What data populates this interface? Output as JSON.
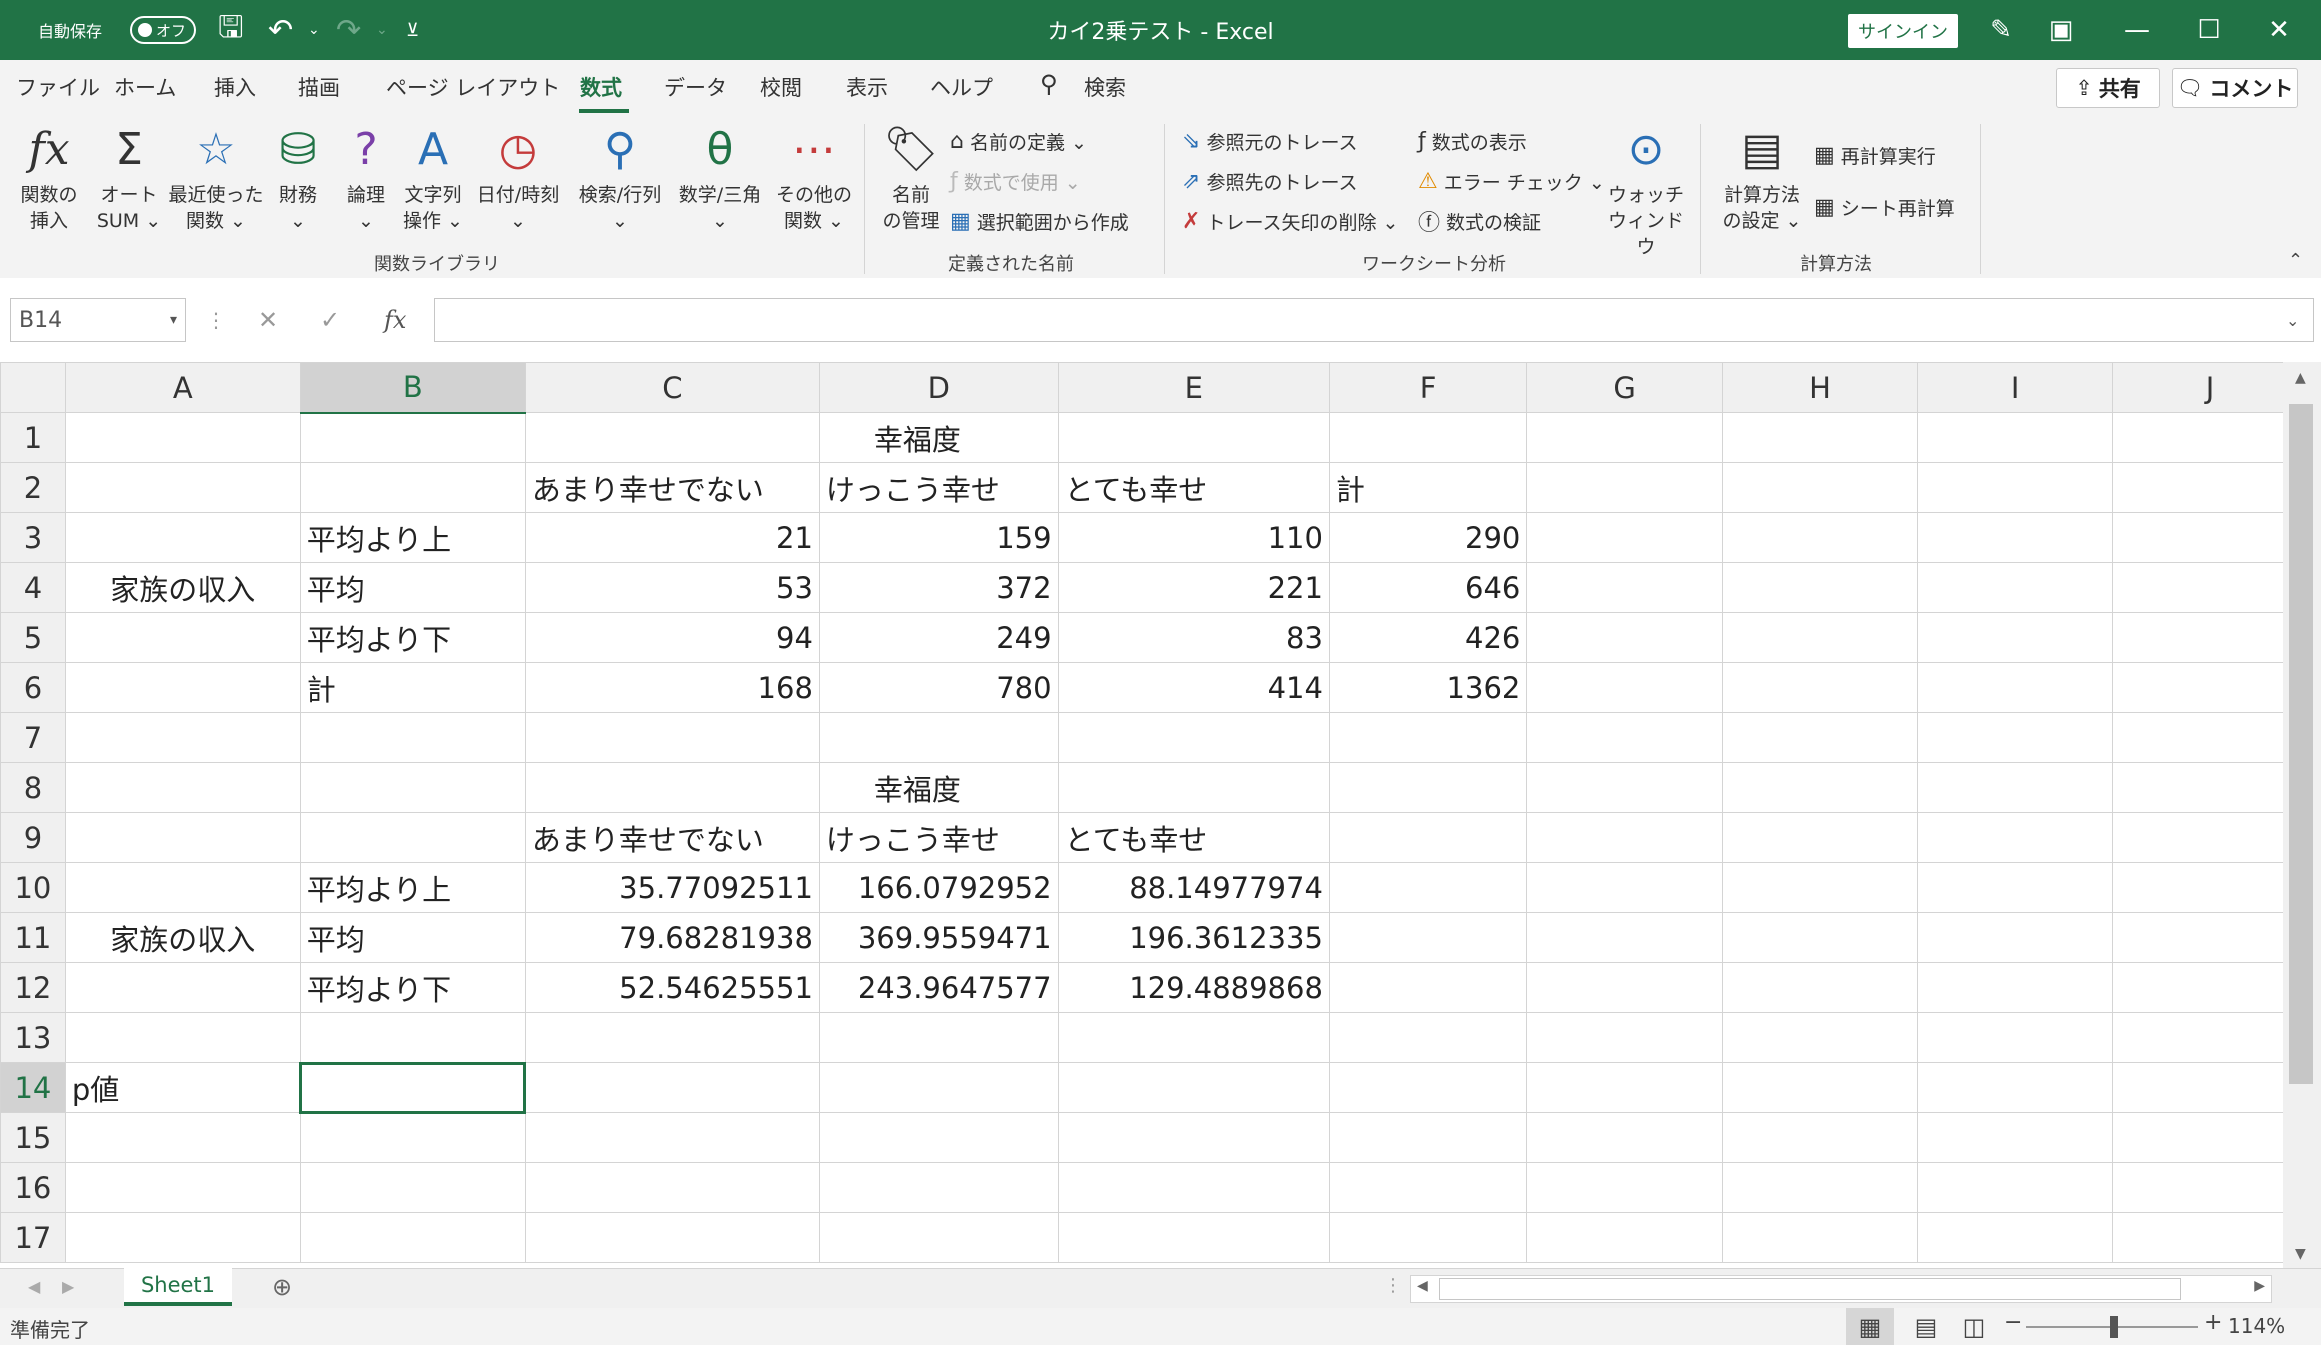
{
  "titlebar": {
    "autosave_label": "自動保存",
    "autosave_state": "オフ",
    "title": "カイ2乗テスト  -  Excel",
    "signin": "サインイン"
  },
  "tabs": [
    "ファイル",
    "ホーム",
    "挿入",
    "描画",
    "ページ レイアウト",
    "数式",
    "データ",
    "校閲",
    "表示",
    "ヘルプ"
  ],
  "active_tab": "数式",
  "search_label": "検索",
  "share_label": "共有",
  "comment_label": "コメント",
  "ribbon": {
    "groups": {
      "function_library": "関数ライブラリ",
      "defined_names": "定義された名前",
      "formula_auditing": "ワークシート分析",
      "calculation": "計算方法"
    },
    "insert_function": [
      "関数の",
      "挿入"
    ],
    "autosum": [
      "オート",
      "SUM ⌄"
    ],
    "recent": [
      "最近使った",
      "関数 ⌄"
    ],
    "financial": [
      "財務",
      "⌄"
    ],
    "logical": [
      "論理",
      "⌄"
    ],
    "text": [
      "文字列",
      "操作 ⌄"
    ],
    "datetime": [
      "日付/時刻",
      "⌄"
    ],
    "lookup": [
      "検索/行列",
      "⌄"
    ],
    "math": [
      "数学/三角",
      "⌄"
    ],
    "more": [
      "その他の",
      "関数 ⌄"
    ],
    "name_manager": [
      "名前",
      "の管理"
    ],
    "define_name": "名前の定義 ⌄",
    "use_in_formula": "数式で使用 ⌄",
    "create_from_selection": "選択範囲から作成",
    "trace_precedents": "参照元のトレース",
    "trace_dependents": "参照先のトレース",
    "remove_arrows": "トレース矢印の削除 ⌄",
    "show_formulas": "数式の表示",
    "error_checking": "エラー チェック ⌄",
    "evaluate_formula": "数式の検証",
    "watch_window": [
      "ウォッチ",
      "ウィンドウ"
    ],
    "calc_options": [
      "計算方法",
      "の設定 ⌄"
    ],
    "calc_now": "再計算実行",
    "calc_sheet": "シート再計算"
  },
  "namebox": "B14",
  "columns": [
    "A",
    "B",
    "C",
    "D",
    "E",
    "F",
    "G",
    "H",
    "I",
    "J"
  ],
  "rows": [
    [
      "",
      "",
      "",
      "幸福度",
      "",
      "",
      "",
      "",
      "",
      ""
    ],
    [
      "",
      "",
      "あまり幸せでない",
      "けっこう幸せ",
      "とても幸せ",
      "計",
      "",
      "",
      "",
      ""
    ],
    [
      "",
      "平均より上",
      "21",
      "159",
      "110",
      "290",
      "",
      "",
      "",
      ""
    ],
    [
      "家族の収入",
      "平均",
      "53",
      "372",
      "221",
      "646",
      "",
      "",
      "",
      ""
    ],
    [
      "",
      "平均より下",
      "94",
      "249",
      "83",
      "426",
      "",
      "",
      "",
      ""
    ],
    [
      "",
      "計",
      "168",
      "780",
      "414",
      "1362",
      "",
      "",
      "",
      ""
    ],
    [
      "",
      "",
      "",
      "",
      "",
      "",
      "",
      "",
      "",
      ""
    ],
    [
      "",
      "",
      "",
      "幸福度",
      "",
      "",
      "",
      "",
      "",
      ""
    ],
    [
      "",
      "",
      "あまり幸せでない",
      "けっこう幸せ",
      "とても幸せ",
      "",
      "",
      "",
      "",
      ""
    ],
    [
      "",
      "平均より上",
      "35.77092511",
      "166.0792952",
      "88.14977974",
      "",
      "",
      "",
      "",
      ""
    ],
    [
      "家族の収入",
      "平均",
      "79.68281938",
      "369.9559471",
      "196.3612335",
      "",
      "",
      "",
      "",
      ""
    ],
    [
      "",
      "平均より下",
      "52.54625551",
      "243.9647577",
      "129.4889868",
      "",
      "",
      "",
      "",
      ""
    ],
    [
      "",
      "",
      "",
      "",
      "",
      "",
      "",
      "",
      "",
      ""
    ],
    [
      "p値",
      "",
      "",
      "",
      "",
      "",
      "",
      "",
      "",
      ""
    ],
    [
      "",
      "",
      "",
      "",
      "",
      "",
      "",
      "",
      "",
      ""
    ],
    [
      "",
      "",
      "",
      "",
      "",
      "",
      "",
      "",
      "",
      ""
    ],
    [
      "",
      "",
      "",
      "",
      "",
      "",
      "",
      "",
      "",
      ""
    ]
  ],
  "sheet_tab": "Sheet1",
  "status": "準備完了",
  "zoom": "114%"
}
